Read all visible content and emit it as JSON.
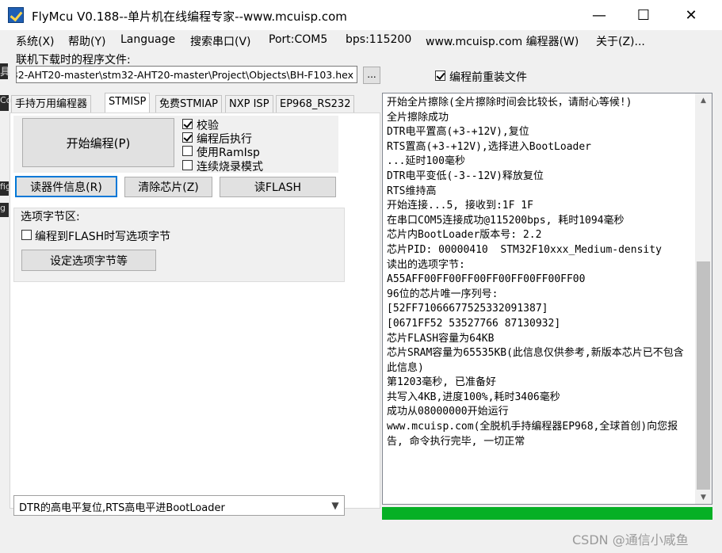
{
  "window": {
    "title": "FlyMcu V0.188--单片机在线编程专家--www.mcuisp.com",
    "minimize_glyph": "—",
    "maximize_glyph": "☐",
    "close_glyph": "✕"
  },
  "menu": [
    {
      "label": "系统(X)"
    },
    {
      "label": "帮助(Y)"
    },
    {
      "label": "Language"
    },
    {
      "label": "搜索串口(V)"
    },
    {
      "label": "Port:COM5"
    },
    {
      "label": "bps:115200"
    },
    {
      "label": "www.mcuisp.com 编程器(W)"
    },
    {
      "label": "关于(Z)..."
    }
  ],
  "background_fragments": [
    "具",
    "Co",
    "fig",
    "g"
  ],
  "file": {
    "label": "联机下载时的程序文件:",
    "path": "\\stm32-AHT20-master\\stm32-AHT20-master\\Project\\Objects\\BH-F103.hex",
    "browse_label": "...",
    "reload_label": "编程前重装文件",
    "reload_checked": true
  },
  "tabs": [
    {
      "label": "手持万用编程器"
    },
    {
      "label": "STMISP"
    },
    {
      "label": "免费STMIAP"
    },
    {
      "label": "NXP ISP"
    },
    {
      "label": "EP968_RS232"
    }
  ],
  "stmisp": {
    "start_button": "开始编程(P)",
    "options": [
      {
        "label": "校验",
        "checked": true
      },
      {
        "label": "编程后执行",
        "checked": true
      },
      {
        "label": "使用RamIsp",
        "checked": false
      },
      {
        "label": "连续烧录模式",
        "checked": false
      }
    ],
    "read_info_button": "读器件信息(R)",
    "erase_button": "清除芯片(Z)",
    "read_flash_button": "读FLASH",
    "option_bytes": {
      "title": "选项字节区:",
      "write_on_program_label": "编程到FLASH时写选项字节",
      "write_on_program_checked": false,
      "set_button": "设定选项字节等"
    },
    "reset_mode": "DTR的高电平复位,RTS高电平进BootLoader"
  },
  "log_lines": [
    "开始全片擦除(全片擦除时间会比较长，请耐心等候!)",
    "全片擦除成功",
    "DTR电平置高(+3-+12V),复位",
    "RTS置高(+3-+12V),选择进入BootLoader",
    "...延时100毫秒",
    "DTR电平变低(-3--12V)释放复位",
    "RTS维持高",
    "开始连接...5, 接收到:1F 1F",
    "在串口COM5连接成功@115200bps, 耗时1094毫秒",
    "芯片内BootLoader版本号: 2.2",
    "芯片PID: 00000410  STM32F10xxx_Medium-density",
    "读出的选项字节:",
    "A55AFF00FF00FF00FF00FF00FF00FF00",
    "96位的芯片唯一序列号:",
    "[52FF71066677525332091387]",
    "[0671FF52 53527766 87130932]",
    "芯片FLASH容量为64KB",
    "芯片SRAM容量为65535KB(此信息仅供参考,新版本芯片已不包含此信息)",
    "第1203毫秒, 已准备好",
    "共写入4KB,进度100%,耗时3406毫秒",
    "成功从08000000开始运行",
    "www.mcuisp.com(全脱机手持编程器EP968,全球首创)向您报告, 命令执行完毕, 一切正常"
  ],
  "progress": {
    "fraction": 1.0,
    "color": "#06b025"
  },
  "watermark": "CSDN @通信小咸鱼"
}
